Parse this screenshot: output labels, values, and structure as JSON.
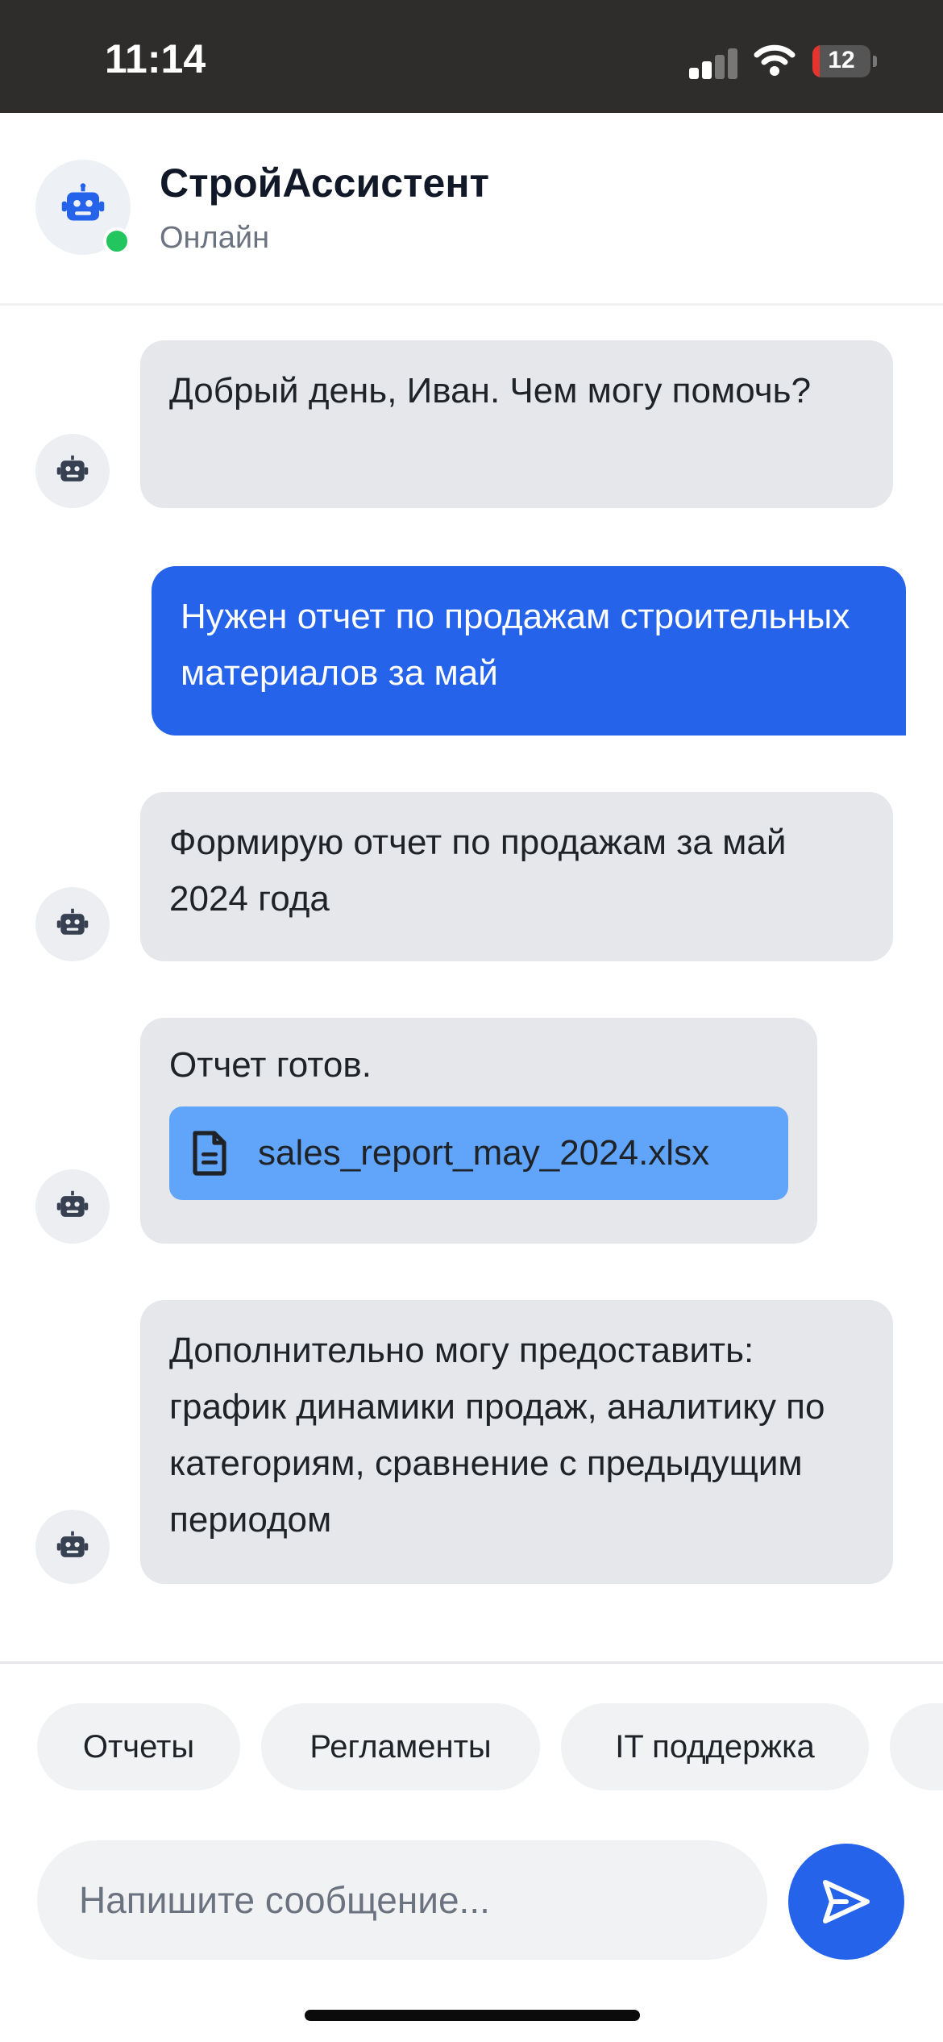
{
  "status_bar": {
    "time": "11:14",
    "battery": "12",
    "battery_level_percent": 12
  },
  "header": {
    "title": "СтройАссистент",
    "status": "Онлайн",
    "online_color": "#22c55e"
  },
  "messages": [
    {
      "from": "bot",
      "text": "Добрый день, Иван. Чем могу помочь?"
    },
    {
      "from": "user",
      "text": "Нужен отчет по продажам строительных материалов за май"
    },
    {
      "from": "bot",
      "text": "Формирую отчет по продажам за май 2024 года"
    },
    {
      "from": "bot",
      "text": "Отчет готов.",
      "attachment": "sales_report_may_2024.xlsx"
    },
    {
      "from": "bot",
      "text": "Дополнительно могу предоставить: график динамики продаж, аналитику по категориям, сравнение с предыдущим периодом"
    }
  ],
  "quick_replies": [
    "Отчеты",
    "Регламенты",
    "IT поддержка"
  ],
  "composer": {
    "placeholder": "Напишите сообщение..."
  },
  "colors": {
    "accent": "#2563eb",
    "attachment": "#60a5fa",
    "bot_bubble": "#e5e7eb"
  },
  "icons": {
    "bot": "robot-icon",
    "file": "file-icon",
    "send": "send-icon"
  }
}
